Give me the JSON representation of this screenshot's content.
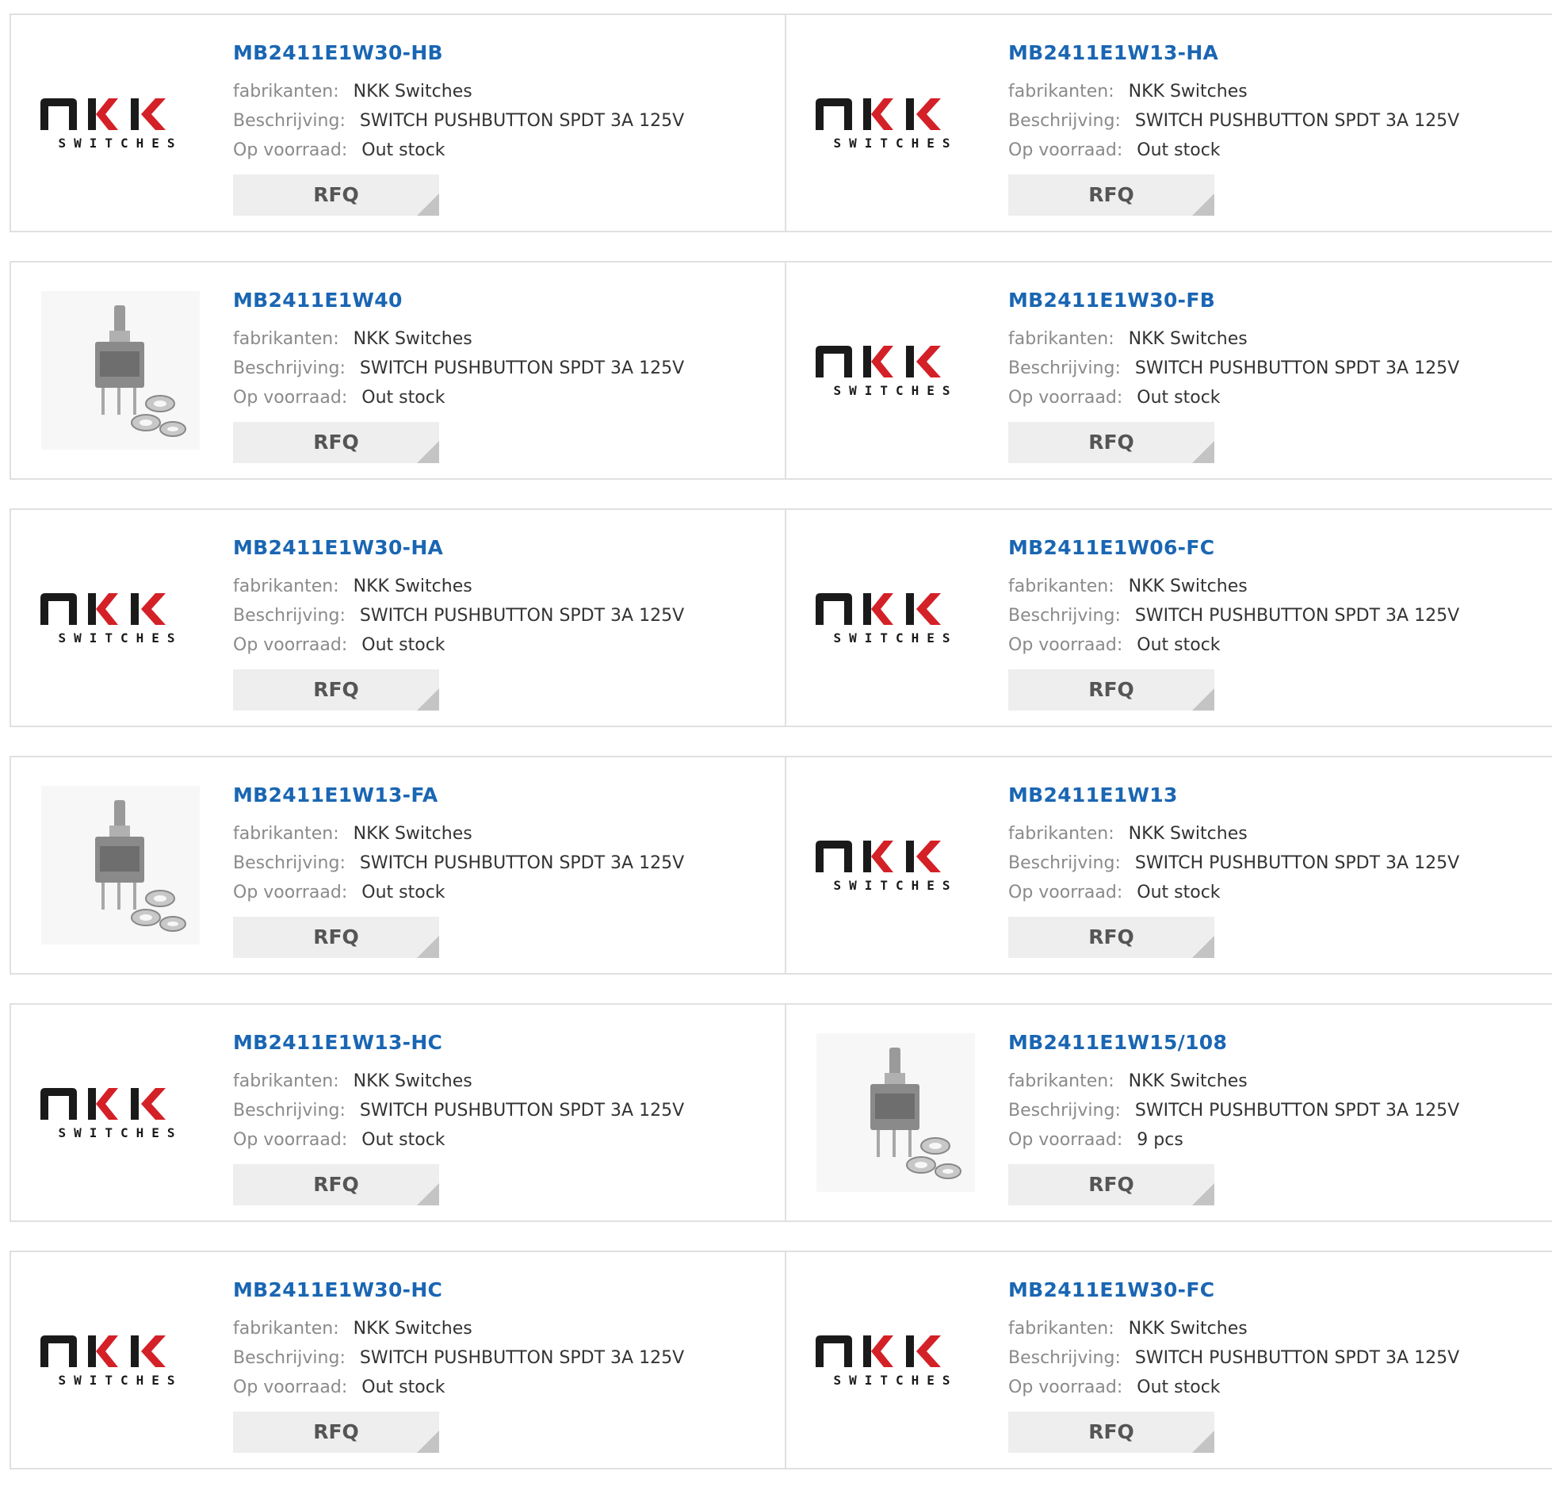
{
  "labels": {
    "manufacturer": "fabrikanten:",
    "description": "Beschrijving:",
    "stock": "Op voorraad:"
  },
  "logo_text": "SWITCHES",
  "products": [
    {
      "title": "MB2411E1W30-HB",
      "manufacturer": "NKK Switches",
      "description": "SWITCH PUSHBUTTON SPDT 3A 125V",
      "stock": "Out stock",
      "button": "RFQ",
      "image": "nkk-logo"
    },
    {
      "title": "MB2411E1W13-HA",
      "manufacturer": "NKK Switches",
      "description": "SWITCH PUSHBUTTON SPDT 3A 125V",
      "stock": "Out stock",
      "button": "RFQ",
      "image": "nkk-logo"
    },
    {
      "title": "MB2411E1W40",
      "manufacturer": "NKK Switches",
      "description": "SWITCH PUSHBUTTON SPDT 3A 125V",
      "stock": "Out stock",
      "button": "RFQ",
      "image": "switch-photo"
    },
    {
      "title": "MB2411E1W30-FB",
      "manufacturer": "NKK Switches",
      "description": "SWITCH PUSHBUTTON SPDT 3A 125V",
      "stock": "Out stock",
      "button": "RFQ",
      "image": "nkk-logo"
    },
    {
      "title": "MB2411E1W30-HA",
      "manufacturer": "NKK Switches",
      "description": "SWITCH PUSHBUTTON SPDT 3A 125V",
      "stock": "Out stock",
      "button": "RFQ",
      "image": "nkk-logo"
    },
    {
      "title": "MB2411E1W06-FC",
      "manufacturer": "NKK Switches",
      "description": "SWITCH PUSHBUTTON SPDT 3A 125V",
      "stock": "Out stock",
      "button": "RFQ",
      "image": "nkk-logo"
    },
    {
      "title": "MB2411E1W13-FA",
      "manufacturer": "NKK Switches",
      "description": "SWITCH PUSHBUTTON SPDT 3A 125V",
      "stock": "Out stock",
      "button": "RFQ",
      "image": "switch-photo"
    },
    {
      "title": "MB2411E1W13",
      "manufacturer": "NKK Switches",
      "description": "SWITCH PUSHBUTTON SPDT 3A 125V",
      "stock": "Out stock",
      "button": "RFQ",
      "image": "nkk-logo"
    },
    {
      "title": "MB2411E1W13-HC",
      "manufacturer": "NKK Switches",
      "description": "SWITCH PUSHBUTTON SPDT 3A 125V",
      "stock": "Out stock",
      "button": "RFQ",
      "image": "nkk-logo"
    },
    {
      "title": "MB2411E1W15/108",
      "manufacturer": "NKK Switches",
      "description": "SWITCH PUSHBUTTON SPDT 3A 125V",
      "stock": "9 pcs",
      "button": "RFQ",
      "image": "switch-photo"
    },
    {
      "title": "MB2411E1W30-HC",
      "manufacturer": "NKK Switches",
      "description": "SWITCH PUSHBUTTON SPDT 3A 125V",
      "stock": "Out stock",
      "button": "RFQ",
      "image": "nkk-logo"
    },
    {
      "title": "MB2411E1W30-FC",
      "manufacturer": "NKK Switches",
      "description": "SWITCH PUSHBUTTON SPDT 3A 125V",
      "stock": "Out stock",
      "button": "RFQ",
      "image": "nkk-logo"
    }
  ],
  "colors": {
    "title": "#1a66b3",
    "logo_dark": "#1a1a1a",
    "logo_red": "#d42027",
    "button_bg": "#eeeeee",
    "border": "#e0e0e0"
  }
}
